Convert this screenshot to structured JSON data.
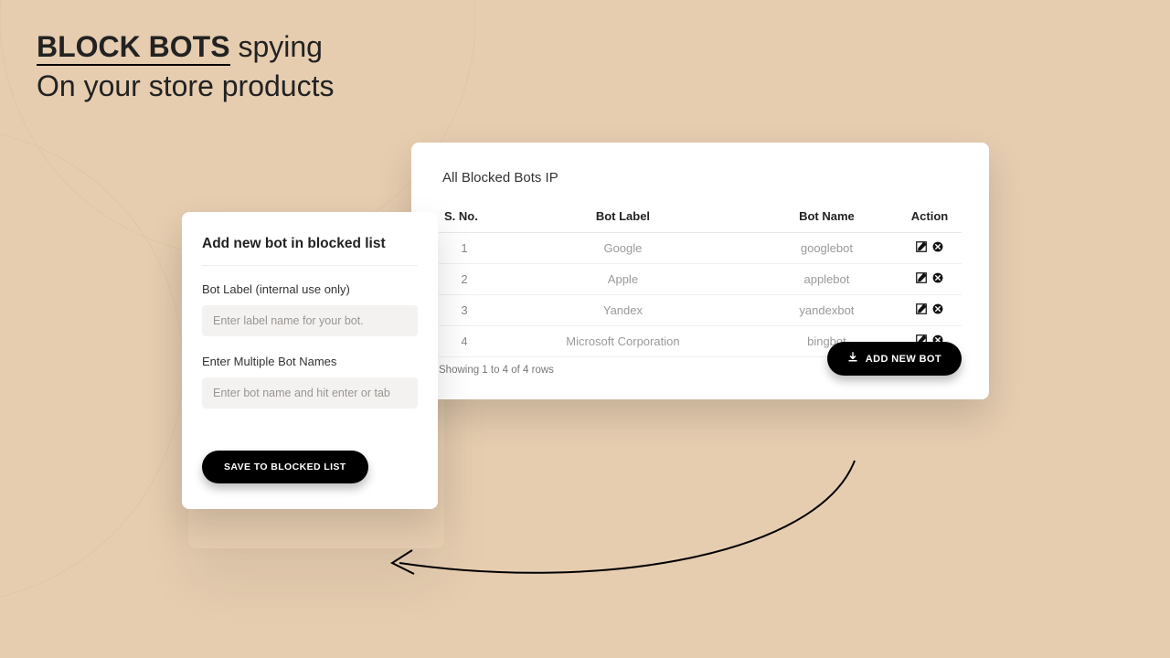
{
  "headline": {
    "bold": "BLOCK BOTS",
    "line1_rest": " spying",
    "line2": "On your store products"
  },
  "form": {
    "title": "Add new bot in blocked list",
    "label_bot_label": "Bot Label (internal use only)",
    "placeholder_bot_label": "Enter label name for your bot.",
    "label_bot_names": "Enter Multiple Bot Names",
    "placeholder_bot_names": "Enter bot name and hit enter or tab",
    "save_label": "SAVE TO BLOCKED LIST"
  },
  "list": {
    "title": "All Blocked Bots IP",
    "columns": {
      "sno": "S. No.",
      "label": "Bot Label",
      "name": "Bot Name",
      "action": "Action"
    },
    "rows": [
      {
        "sno": "1",
        "label": "Google",
        "name": "googlebot"
      },
      {
        "sno": "2",
        "label": "Apple",
        "name": "applebot"
      },
      {
        "sno": "3",
        "label": "Yandex",
        "name": "yandexbot"
      },
      {
        "sno": "4",
        "label": "Microsoft Corporation",
        "name": "bingbot"
      }
    ],
    "pager": "Showing 1 to 4 of 4 rows",
    "add_label": "ADD NEW BOT"
  },
  "icons": {
    "edit": "edit-icon",
    "delete": "delete-icon",
    "download": "download-icon"
  }
}
